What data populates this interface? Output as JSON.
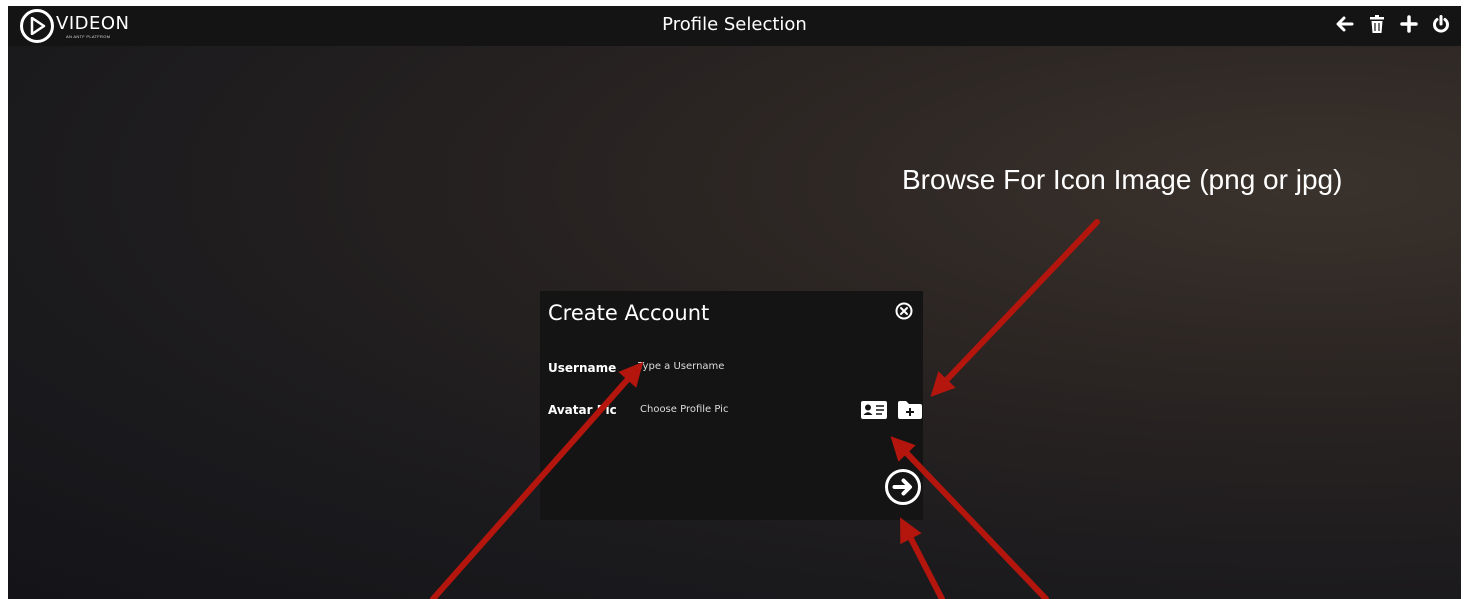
{
  "header": {
    "logo_text": "VIDEON",
    "logo_subtext": "AN ANTF PLATFROM",
    "title": "Profile Selection"
  },
  "toolbar": {
    "icons": [
      "back-arrow-icon",
      "trash-icon",
      "plus-icon",
      "power-icon"
    ]
  },
  "annotation": {
    "note": "Browse For Icon Image (png or jpg)",
    "arrow_color": "#b4160e"
  },
  "modal": {
    "title": "Create Account",
    "username_label": "Username",
    "username_placeholder": "Type a Username",
    "avatar_label": "Avatar Pic",
    "avatar_placeholder": "Choose Profile Pic"
  }
}
